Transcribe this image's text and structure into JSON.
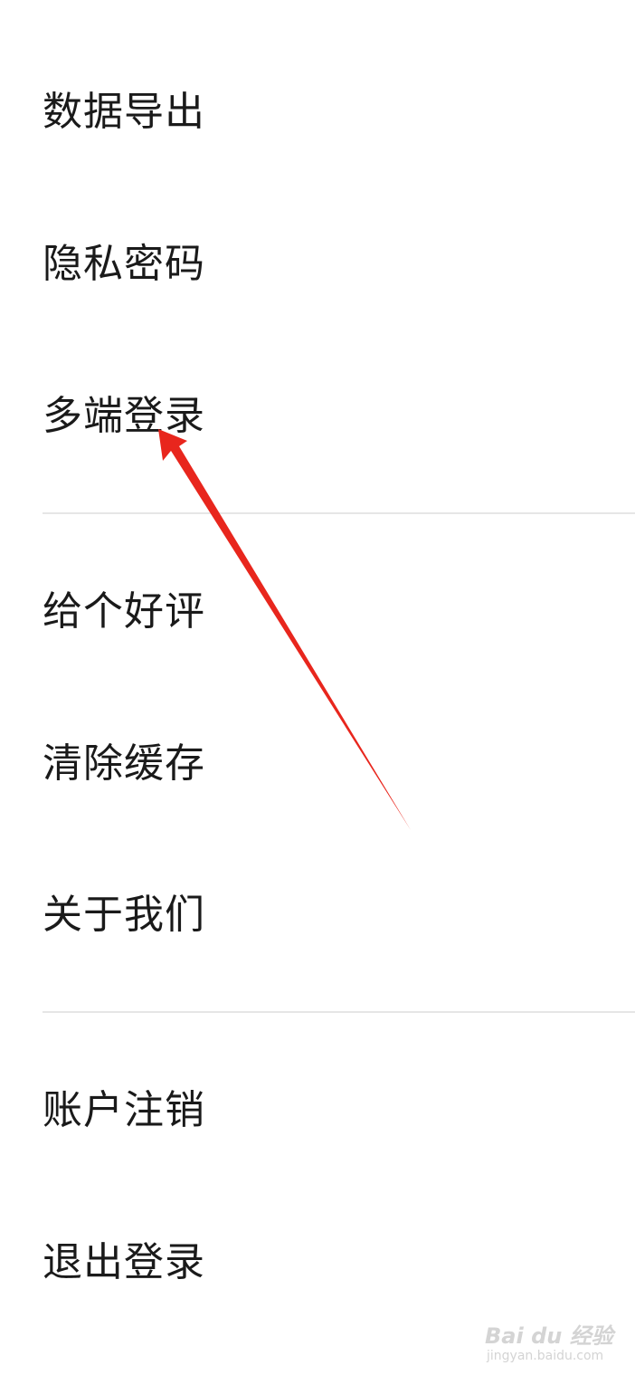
{
  "menu": {
    "group1": [
      {
        "label": "数据导出"
      },
      {
        "label": "隐私密码"
      },
      {
        "label": "多端登录"
      }
    ],
    "group2": [
      {
        "label": "给个好评"
      },
      {
        "label": "清除缓存"
      },
      {
        "label": "关于我们"
      }
    ],
    "group3": [
      {
        "label": "账户注销"
      },
      {
        "label": "退出登录"
      }
    ]
  },
  "annotation": {
    "arrow_color": "#e8261d",
    "points_to": "多端登录"
  },
  "watermark": {
    "brand": "Bai du 经验",
    "url": "jingyan.baidu.com"
  }
}
